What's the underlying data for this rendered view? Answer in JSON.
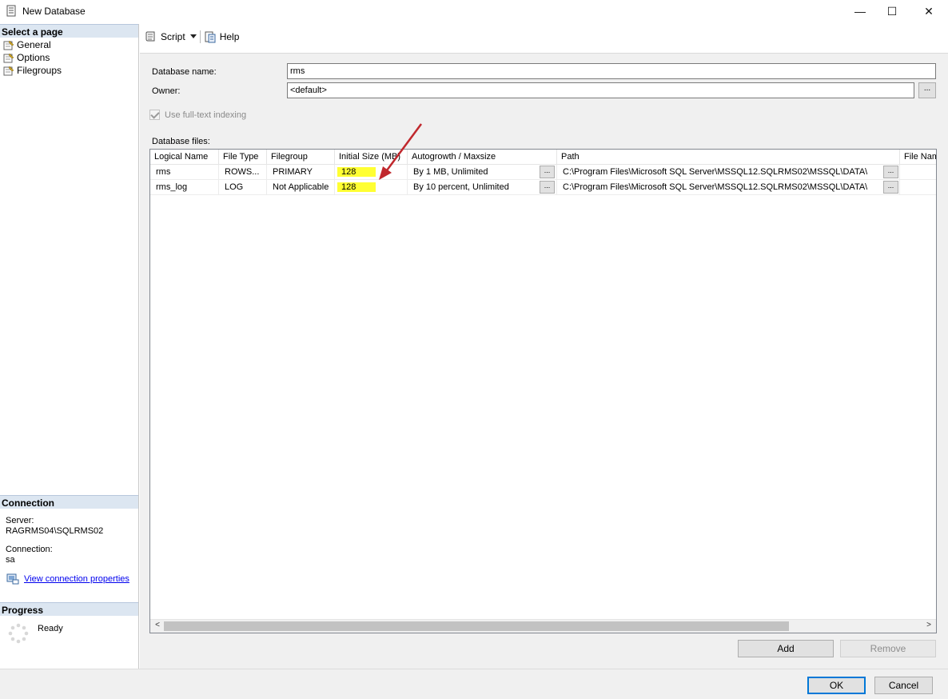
{
  "window": {
    "title": "New Database",
    "minimize_glyph": "—",
    "maximize_glyph": "☐",
    "close_glyph": "✕"
  },
  "left": {
    "select_page_header": "Select a page",
    "pages": [
      {
        "label": "General"
      },
      {
        "label": "Options"
      },
      {
        "label": "Filegroups"
      }
    ],
    "connection_header": "Connection",
    "server_label": "Server:",
    "server_value": "RAGRMS04\\SQLRMS02",
    "connection_label": "Connection:",
    "connection_value": "sa",
    "view_connection_link": "View connection properties",
    "progress_header": "Progress",
    "progress_status": "Ready"
  },
  "toolbar": {
    "script_label": "Script",
    "help_label": "Help"
  },
  "form": {
    "db_name_label": "Database name:",
    "db_name_value": "rms",
    "owner_label": "Owner:",
    "owner_value": "<default>",
    "ellipsis": "...",
    "fulltext_label": "Use full-text indexing",
    "fulltext_checked": true,
    "files_label": "Database files:"
  },
  "grid": {
    "columns": [
      "Logical Name",
      "File Type",
      "Filegroup",
      "Initial Size (MB)",
      "Autogrowth / Maxsize",
      "Path",
      "File Nam"
    ],
    "rows": [
      {
        "logical": "rms",
        "type": "ROWS...",
        "filegroup": "PRIMARY",
        "size": "128",
        "autogrowth": "By 1 MB, Unlimited",
        "path": "C:\\Program Files\\Microsoft SQL Server\\MSSQL12.SQLRMS02\\MSSQL\\DATA\\"
      },
      {
        "logical": "rms_log",
        "type": "LOG",
        "filegroup": "Not Applicable",
        "size": "128",
        "autogrowth": "By 10 percent, Unlimited",
        "path": "C:\\Program Files\\Microsoft SQL Server\\MSSQL12.SQLRMS02\\MSSQL\\DATA\\"
      }
    ],
    "scroll_left": "<",
    "scroll_right": ">"
  },
  "buttons": {
    "add": "Add",
    "remove": "Remove",
    "ok": "OK",
    "cancel": "Cancel"
  },
  "colors": {
    "highlight": "#ffff33",
    "annotation_arrow": "#c0282d",
    "section_header_bg": "#dce6f1",
    "link": "#0000ee"
  }
}
